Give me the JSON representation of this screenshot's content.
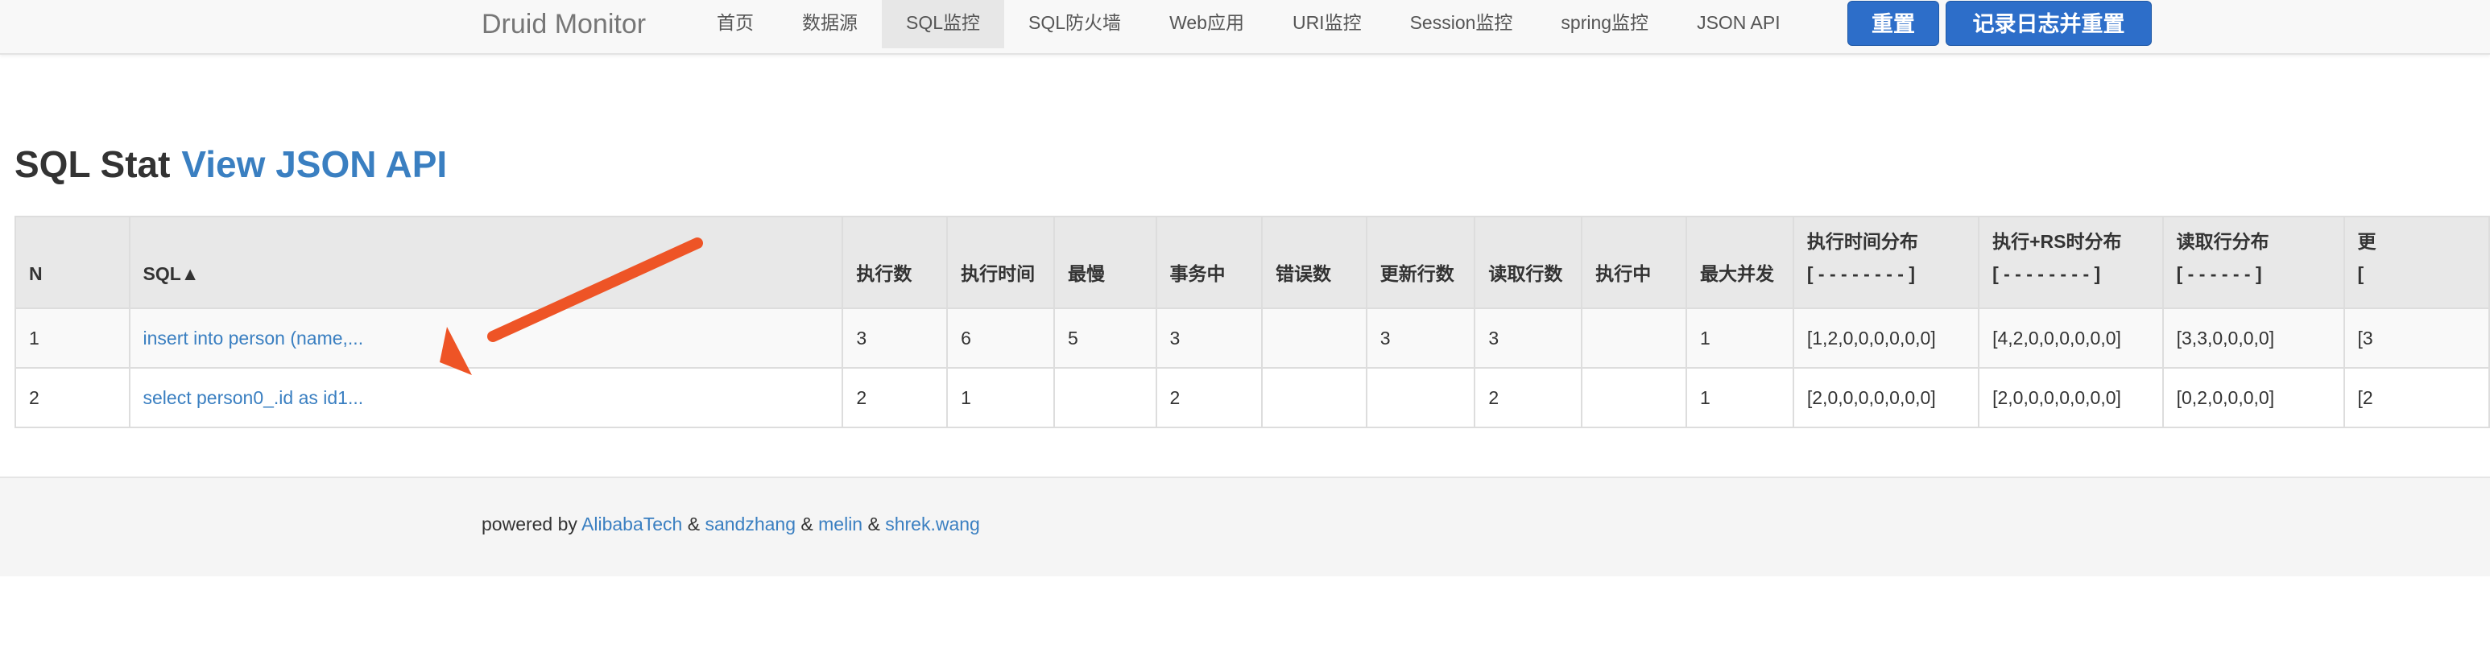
{
  "navbar": {
    "brand": "Druid Monitor",
    "items": [
      {
        "label": "首页",
        "active": false
      },
      {
        "label": "数据源",
        "active": false
      },
      {
        "label": "SQL监控",
        "active": true
      },
      {
        "label": "SQL防火墙",
        "active": false
      },
      {
        "label": "Web应用",
        "active": false
      },
      {
        "label": "URI监控",
        "active": false
      },
      {
        "label": "Session监控",
        "active": false
      },
      {
        "label": "spring监控",
        "active": false
      },
      {
        "label": "JSON API",
        "active": false
      }
    ],
    "reset_button": "重置",
    "log_reset_button": "记录日志并重置"
  },
  "heading": {
    "title": "SQL Stat",
    "link": "View JSON API"
  },
  "table": {
    "headers": [
      {
        "line1": "",
        "line2": "N"
      },
      {
        "line1": "",
        "line2": "SQL▲"
      },
      {
        "line1": "",
        "line2": "执行数"
      },
      {
        "line1": "",
        "line2": "执行时间"
      },
      {
        "line1": "",
        "line2": "最慢"
      },
      {
        "line1": "",
        "line2": "事务中"
      },
      {
        "line1": "",
        "line2": "错误数"
      },
      {
        "line1": "",
        "line2": "更新行数"
      },
      {
        "line1": "",
        "line2": "读取行数"
      },
      {
        "line1": "",
        "line2": "执行中"
      },
      {
        "line1": "",
        "line2": "最大并发"
      },
      {
        "line1": "执行时间分布",
        "line2": "[ - - - - - - - - ]"
      },
      {
        "line1": "执行+RS时分布",
        "line2": "[ - - - - - - - - ]"
      },
      {
        "line1": "读取行分布",
        "line2": "[ - - - - - - ]"
      },
      {
        "line1": "更",
        "line2": "["
      }
    ],
    "rows": [
      [
        "1",
        "insert into person (name,...",
        "3",
        "6",
        "5",
        "3",
        "",
        "3",
        "3",
        "",
        "1",
        "[1,2,0,0,0,0,0,0]",
        "[4,2,0,0,0,0,0,0]",
        "[3,3,0,0,0,0]",
        "[3"
      ],
      [
        "2",
        "select person0_.id as id1...",
        "2",
        "1",
        "",
        "2",
        "",
        "",
        "2",
        "",
        "1",
        "[2,0,0,0,0,0,0,0]",
        "[2,0,0,0,0,0,0,0]",
        "[0,2,0,0,0,0]",
        "[2"
      ]
    ]
  },
  "footer": {
    "prefix": "powered by ",
    "links": [
      "AlibabaTech",
      "sandzhang",
      "melin",
      "shrek.wang"
    ],
    "separator": " & "
  },
  "annotation": {
    "arrow_color": "#ee5426"
  }
}
